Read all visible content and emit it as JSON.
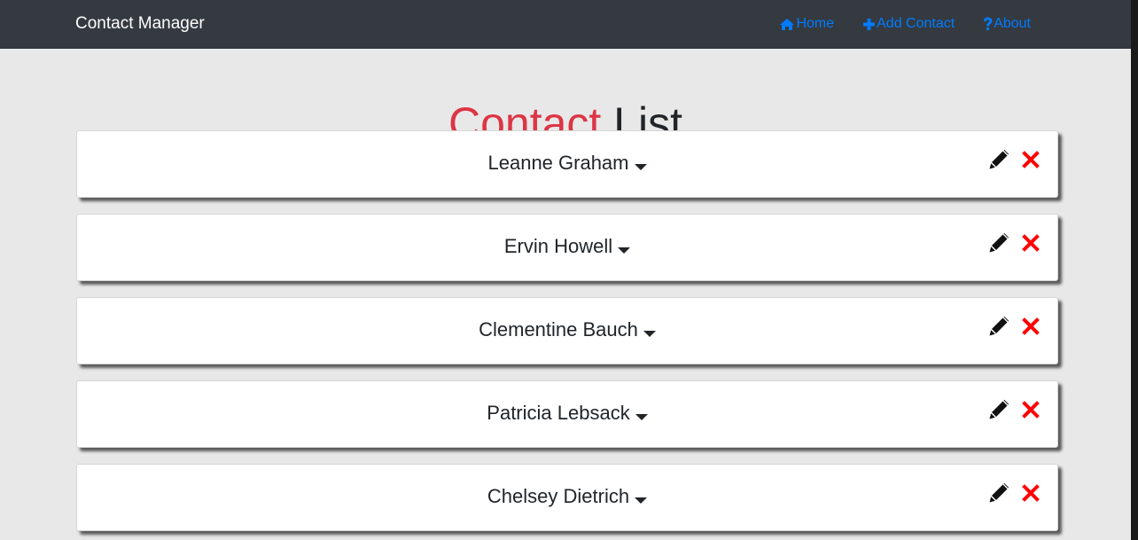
{
  "navbar": {
    "brand": "Contact Manager",
    "links": [
      {
        "label": "Home",
        "icon": "home-icon"
      },
      {
        "label": "Add Contact",
        "icon": "plus-icon"
      },
      {
        "label": "About",
        "icon": "question-icon"
      }
    ]
  },
  "page": {
    "title_accent": "Contact",
    "title_rest": "List"
  },
  "contacts": [
    {
      "name": "Leanne Graham"
    },
    {
      "name": "Ervin Howell"
    },
    {
      "name": "Clementine Bauch"
    },
    {
      "name": "Patricia Lebsack"
    },
    {
      "name": "Chelsey Dietrich"
    }
  ],
  "colors": {
    "navbar_bg": "#343a40",
    "link": "#007bff",
    "accent_red": "#dc3545",
    "delete_red": "#ff0000",
    "background": "#e8e8e8"
  }
}
